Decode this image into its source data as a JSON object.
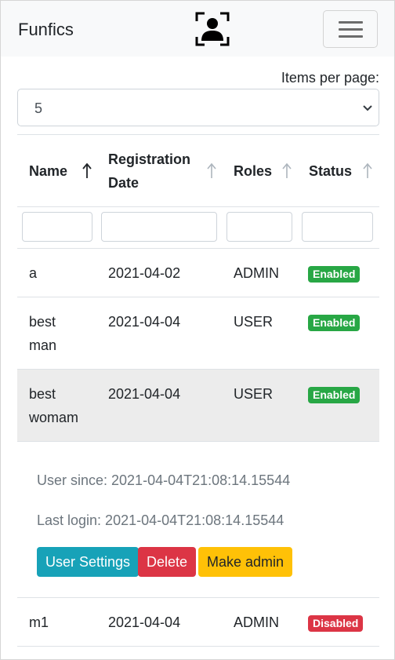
{
  "navbar": {
    "brand": "Funfics",
    "logo_icon": "user-portrait-scan-icon",
    "menu_icon": "hamburger-menu-icon"
  },
  "controls": {
    "items_per_page_label": "Items per page:",
    "items_per_page_value": "5"
  },
  "table": {
    "columns": [
      {
        "label": "Name",
        "sort_icon": "sort-arrow-up-icon"
      },
      {
        "label_line1": "Registration",
        "label_line2": "Date",
        "sort_icon": "sort-arrow-up-icon"
      },
      {
        "label": "Roles",
        "sort_icon": "sort-arrow-up-icon"
      },
      {
        "label": "Status",
        "sort_icon": "sort-arrow-up-icon"
      }
    ],
    "rows": [
      {
        "name_line1": "a",
        "name_line2": "",
        "date": "2021-04-02",
        "role": "ADMIN",
        "status": "Enabled"
      },
      {
        "name_line1": "best",
        "name_line2": "man",
        "date": "2021-04-04",
        "role": "USER",
        "status": "Enabled"
      },
      {
        "name_line1": "best",
        "name_line2": "womam",
        "date": "2021-04-04",
        "role": "USER",
        "status": "Enabled"
      },
      {
        "name_line1": "m1",
        "name_line2": "",
        "date": "2021-04-04",
        "role": "ADMIN",
        "status": "Disabled"
      }
    ],
    "expanded_details": {
      "user_since": "User since: 2021-04-04T21:08:14.15544",
      "last_login": "Last login: 2021-04-04T21:08:14.15544",
      "buttons": {
        "settings": "User Settings",
        "delete": "Delete",
        "make_admin": "Make admin"
      }
    }
  },
  "colors": {
    "navbar_bg": "#f8f9fa",
    "enabled": "#28a745",
    "disabled": "#dc3545",
    "info": "#17a2b8",
    "warning": "#ffc107",
    "selected_row_bg": "#ececec"
  }
}
